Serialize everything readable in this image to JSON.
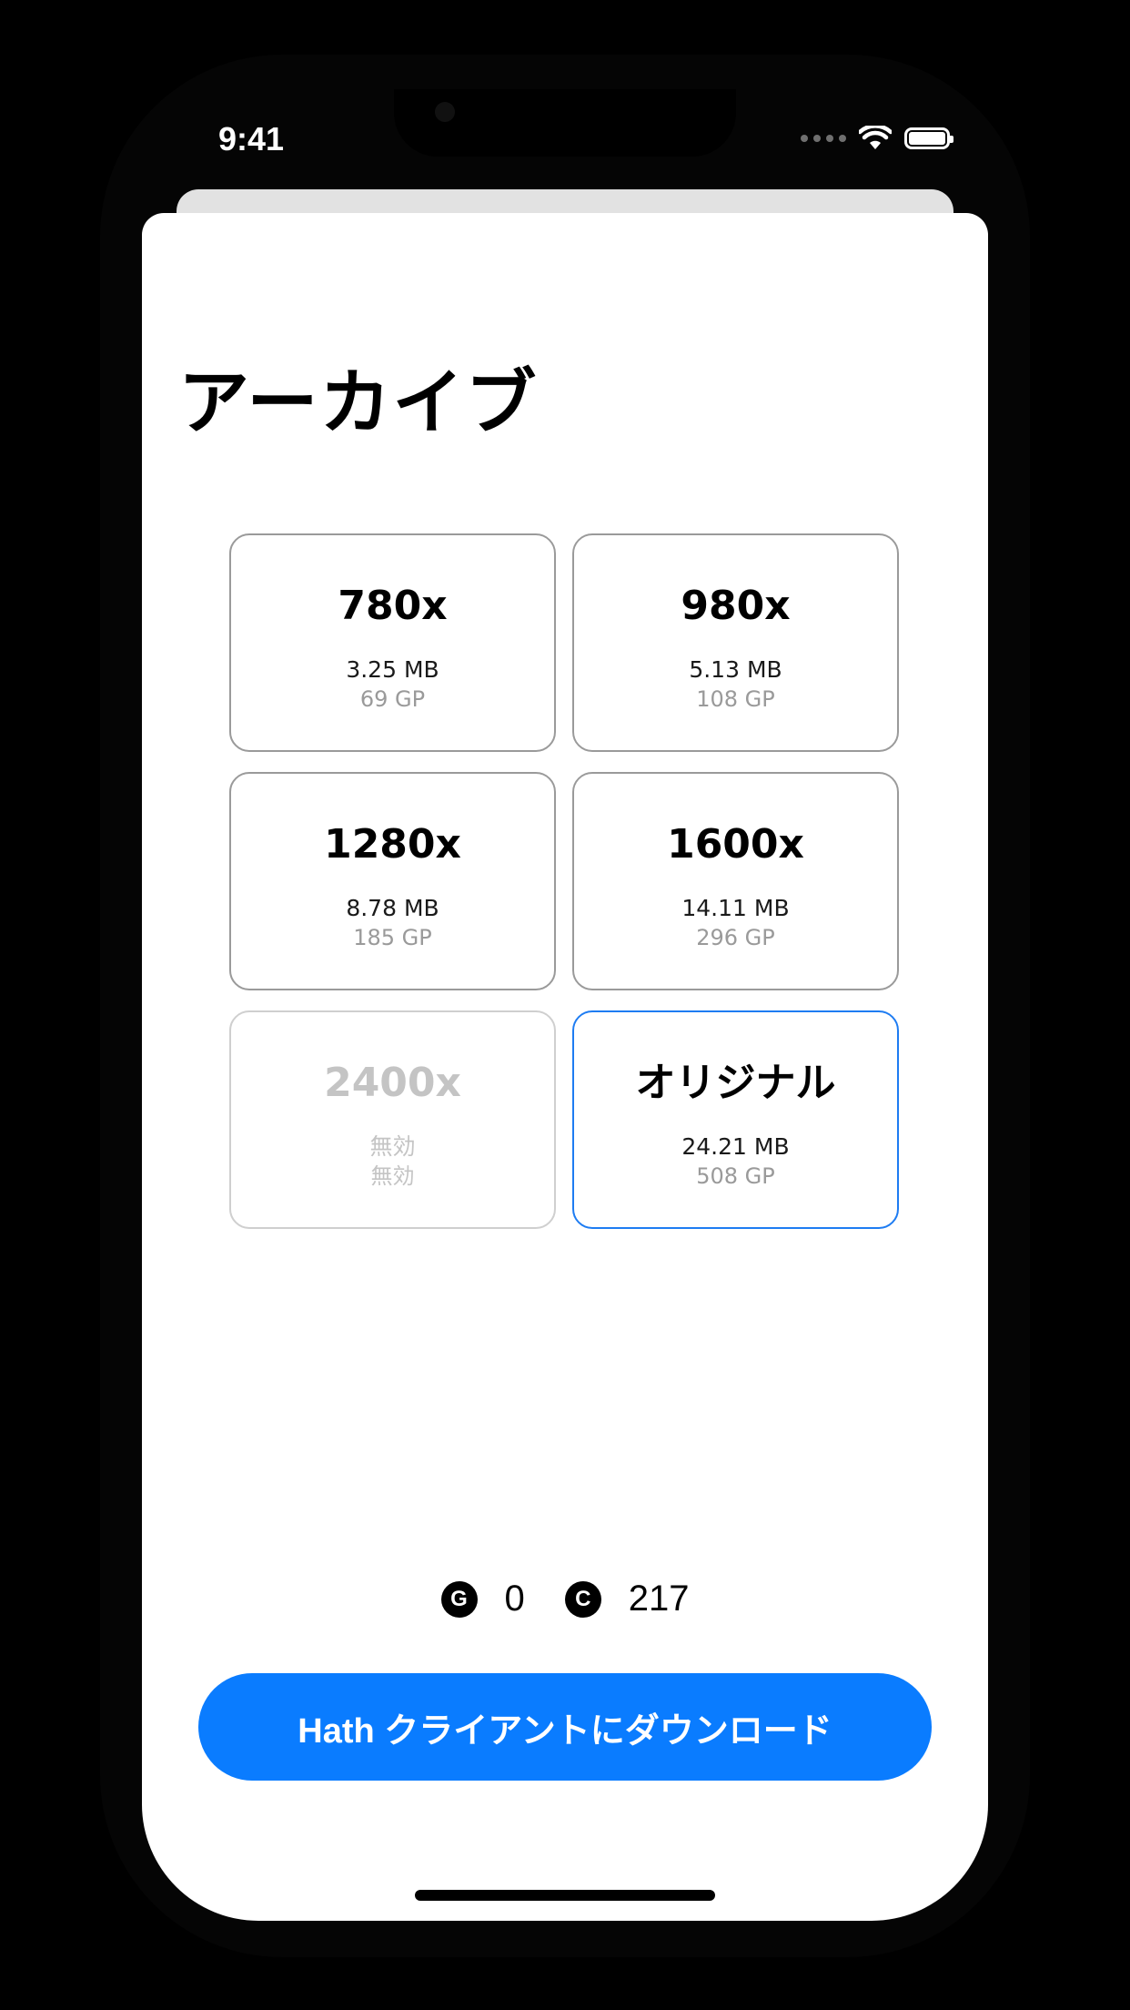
{
  "status_bar": {
    "time": "9:41"
  },
  "header": {
    "title": "アーカイブ"
  },
  "options": [
    {
      "resolution": "780x",
      "size": "3.25 MB",
      "cost": "69 GP",
      "state": "enabled"
    },
    {
      "resolution": "980x",
      "size": "5.13 MB",
      "cost": "108 GP",
      "state": "enabled"
    },
    {
      "resolution": "1280x",
      "size": "8.78 MB",
      "cost": "185 GP",
      "state": "enabled"
    },
    {
      "resolution": "1600x",
      "size": "14.11 MB",
      "cost": "296 GP",
      "state": "enabled"
    },
    {
      "resolution": "2400x",
      "size": "無効",
      "cost": "無効",
      "state": "disabled"
    },
    {
      "resolution": "オリジナル",
      "size": "24.21 MB",
      "cost": "508 GP",
      "state": "selected"
    }
  ],
  "balance": {
    "gp_icon": "G",
    "gp_value": "0",
    "credits_icon": "C",
    "credits_value": "217"
  },
  "actions": {
    "download_label": "Hath クライアントにダウンロード"
  },
  "colors": {
    "accent": "#0a7cff",
    "selected_border": "#1e7cf2",
    "disabled_text": "#c4c4c4"
  }
}
